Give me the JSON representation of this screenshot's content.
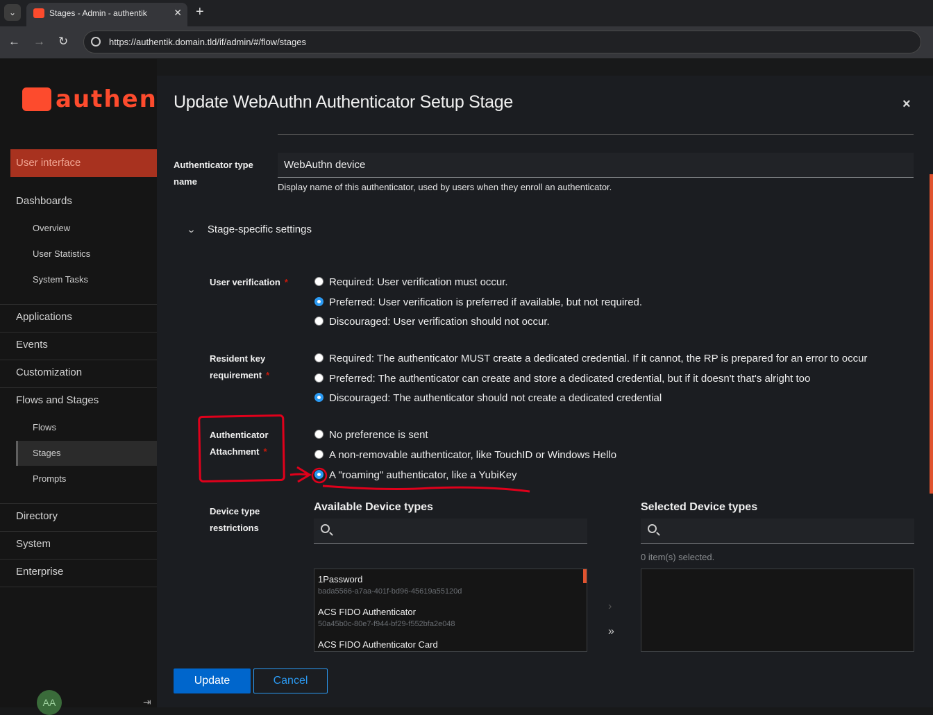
{
  "browser": {
    "tab_title": "Stages - Admin - authentik",
    "url": "https://authentik.domain.tld/if/admin/#/flow/stages"
  },
  "sidebar": {
    "logo_text": "authent",
    "ui_link": "User interface",
    "groups": {
      "dashboards": "Dashboards",
      "overview": "Overview",
      "user_statistics": "User Statistics",
      "system_tasks": "System Tasks",
      "applications": "Applications",
      "events": "Events",
      "customization": "Customization",
      "flows_and_stages": "Flows and Stages",
      "flows": "Flows",
      "stages": "Stages",
      "prompts": "Prompts",
      "directory": "Directory",
      "system": "System",
      "enterprise": "Enterprise"
    },
    "avatar_initials": "AA"
  },
  "modal": {
    "title": "Update WebAuthn Authenticator Setup Stage",
    "close_symbol": "×",
    "authenticator_type_label_1": "Authenticator type",
    "authenticator_type_label_2": "name",
    "authenticator_type_value": "WebAuthn device",
    "authenticator_type_help": "Display name of this authenticator, used by users when they enroll an authenticator.",
    "section_title": "Stage-specific settings",
    "user_verification": {
      "label": "User verification",
      "options": [
        {
          "label": "Required: User verification must occur.",
          "selected": false
        },
        {
          "label": "Preferred: User verification is preferred if available, but not required.",
          "selected": true
        },
        {
          "label": "Discouraged: User verification should not occur.",
          "selected": false
        }
      ]
    },
    "resident_key": {
      "label_1": "Resident key",
      "label_2": "requirement",
      "options": [
        {
          "label": "Required: The authenticator MUST create a dedicated credential. If it cannot, the RP is prepared for an error to occur",
          "selected": false
        },
        {
          "label": "Preferred: The authenticator can create and store a dedicated credential, but if it doesn't that's alright too",
          "selected": false
        },
        {
          "label": "Discouraged: The authenticator should not create a dedicated credential",
          "selected": true
        }
      ]
    },
    "attachment": {
      "label_1": "Authenticator",
      "label_2": "Attachment",
      "options": [
        {
          "label": "No preference is sent",
          "selected": false
        },
        {
          "label": "A non-removable authenticator, like TouchID or Windows Hello",
          "selected": false
        },
        {
          "label": "A \"roaming\" authenticator, like a YubiKey",
          "selected": true
        }
      ]
    },
    "device_types": {
      "label_1": "Device type",
      "label_2": "restrictions",
      "available_title": "Available Device types",
      "selected_title": "Selected Device types",
      "selected_status": "0 item(s) selected.",
      "available_items": [
        {
          "name": "1Password",
          "id": "bada5566-a7aa-401f-bd96-45619a55120d"
        },
        {
          "name": "ACS FIDO Authenticator",
          "id": "50a45b0c-80e7-f944-bf29-f552bfa2e048"
        },
        {
          "name": "ACS FIDO Authenticator Card",
          "id": ""
        }
      ],
      "move_one": "›",
      "move_all": "»"
    },
    "update_label": "Update",
    "cancel_label": "Cancel"
  },
  "colors": {
    "accent": "#fd4b2d",
    "primary": "#0066cc",
    "radio_selected": "#2b9af3",
    "annotation": "#e0001b"
  }
}
